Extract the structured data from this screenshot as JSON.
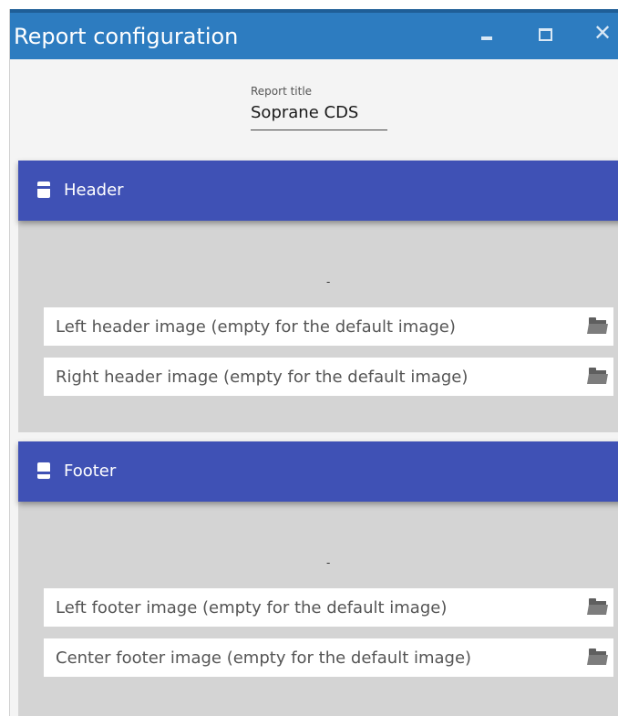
{
  "window": {
    "title": "Report configuration",
    "minimize_glyph": "",
    "maximize_glyph": "",
    "close_glyph": "✕"
  },
  "report_title": {
    "label": "Report title",
    "value": "Soprane CDS"
  },
  "header_section": {
    "label": "Header",
    "icon": "header-layout-icon",
    "center_placeholder": "-",
    "fields": [
      {
        "placeholder": "Left header image (empty for the default image)",
        "value": ""
      },
      {
        "placeholder": "Right header image (empty for the default image)",
        "value": ""
      }
    ]
  },
  "footer_section": {
    "label": "Footer",
    "icon": "footer-layout-icon",
    "center_placeholder": "-",
    "fields": [
      {
        "placeholder": "Left footer image (empty for the default image)",
        "value": ""
      },
      {
        "placeholder": "Center footer image (empty for the default image)",
        "value": ""
      }
    ]
  },
  "colors": {
    "titlebar": "#2d7cc0",
    "section_bar": "#3f51b5",
    "section_body": "#d4d4d4"
  }
}
